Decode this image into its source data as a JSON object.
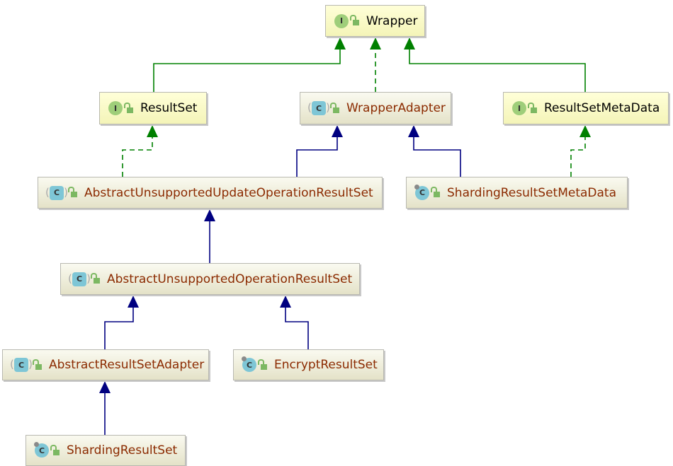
{
  "nodes": {
    "wrapper": {
      "label": "Wrapper",
      "kind": "interface"
    },
    "result_set": {
      "label": "ResultSet",
      "kind": "interface"
    },
    "wrapper_adapter": {
      "label": "WrapperAdapter",
      "kind": "abstract-class"
    },
    "result_set_meta_data": {
      "label": "ResultSetMetaData",
      "kind": "interface"
    },
    "abstract_unsupported_update": {
      "label": "AbstractUnsupportedUpdateOperationResultSet",
      "kind": "abstract-class"
    },
    "sharding_result_set_meta_data": {
      "label": "ShardingResultSetMetaData",
      "kind": "final-class"
    },
    "abstract_unsupported_operation": {
      "label": "AbstractUnsupportedOperationResultSet",
      "kind": "abstract-class"
    },
    "abstract_result_set_adapter": {
      "label": "AbstractResultSetAdapter",
      "kind": "abstract-class"
    },
    "encrypt_result_set": {
      "label": "EncryptResultSet",
      "kind": "final-class"
    },
    "sharding_result_set": {
      "label": "ShardingResultSet",
      "kind": "final-class"
    }
  },
  "icons": {
    "interface": "I",
    "class": "C"
  },
  "colors": {
    "implements": "#008000",
    "extends": "#000080",
    "class_text": "#8b2a00"
  },
  "edges": [
    {
      "from": "ResultSet",
      "to": "Wrapper",
      "type": "extends-interface"
    },
    {
      "from": "WrapperAdapter",
      "to": "Wrapper",
      "type": "implements"
    },
    {
      "from": "ResultSetMetaData",
      "to": "Wrapper",
      "type": "extends-interface"
    },
    {
      "from": "AbstractUnsupportedUpdateOperationResultSet",
      "to": "ResultSet",
      "type": "implements"
    },
    {
      "from": "AbstractUnsupportedUpdateOperationResultSet",
      "to": "WrapperAdapter",
      "type": "extends"
    },
    {
      "from": "ShardingResultSetMetaData",
      "to": "WrapperAdapter",
      "type": "extends"
    },
    {
      "from": "ShardingResultSetMetaData",
      "to": "ResultSetMetaData",
      "type": "implements"
    },
    {
      "from": "AbstractUnsupportedOperationResultSet",
      "to": "AbstractUnsupportedUpdateOperationResultSet",
      "type": "extends"
    },
    {
      "from": "AbstractResultSetAdapter",
      "to": "AbstractUnsupportedOperationResultSet",
      "type": "extends"
    },
    {
      "from": "EncryptResultSet",
      "to": "AbstractUnsupportedOperationResultSet",
      "type": "extends"
    },
    {
      "from": "ShardingResultSet",
      "to": "AbstractResultSetAdapter",
      "type": "extends"
    }
  ]
}
